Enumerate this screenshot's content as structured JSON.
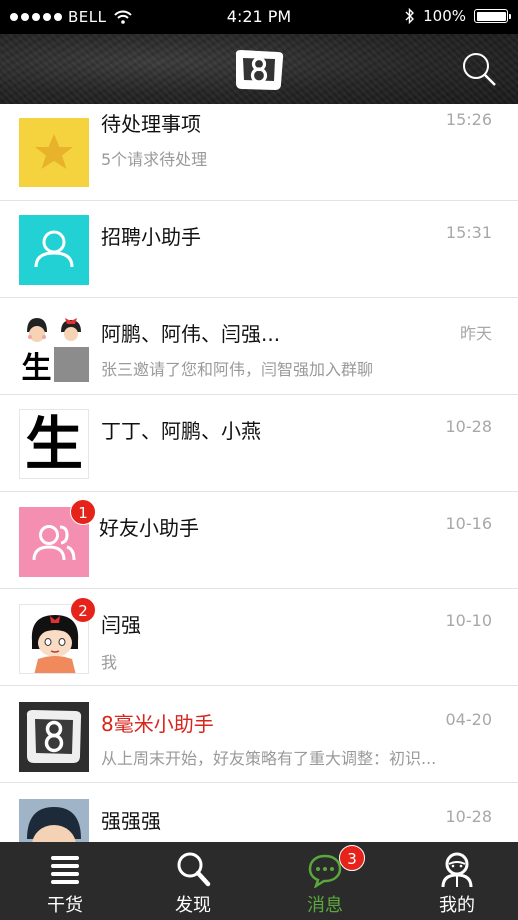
{
  "status_bar": {
    "carrier": "BELL",
    "time": "4:21 PM",
    "battery": "100%"
  },
  "header": {
    "logo_text": "8"
  },
  "messages": [
    {
      "title": "待处理事项",
      "time": "15:26",
      "subtitle": "5个请求待处理",
      "avatar": "star-icon",
      "avatar_color": "#f5d33f"
    },
    {
      "title": "招聘小助手",
      "time": "15:31",
      "subtitle": "",
      "avatar": "person-icon",
      "avatar_color": "#22d1d4"
    },
    {
      "title": "阿鹏、阿伟、闫强...",
      "time": "昨天",
      "subtitle": "张三邀请了您和阿伟，闫智强加入群聊",
      "avatar": "group-avatar"
    },
    {
      "title": "丁丁、阿鹏、小燕",
      "time": "10-28",
      "subtitle": "",
      "avatar": "calligraphy-avatar",
      "avatar_char": "生"
    },
    {
      "title": "好友小助手",
      "time": "10-16",
      "subtitle": "",
      "avatar": "friends-icon",
      "avatar_color": "#f48fb1",
      "badge": "1"
    },
    {
      "title": "闫强",
      "time": "10-10",
      "subtitle": "我",
      "avatar": "cartoon-girl-avatar",
      "badge": "2"
    },
    {
      "title": "8毫米小助手",
      "time": "04-20",
      "subtitle": "从上周末开始，好友策略有了重大调整：初识...",
      "avatar": "app-logo-avatar",
      "highlight_color": "#d9251c"
    },
    {
      "title": "强强强",
      "time": "10-28",
      "subtitle": "",
      "avatar": "cartoon-avatar"
    }
  ],
  "tabs": [
    {
      "label": "干货",
      "icon": "list-icon"
    },
    {
      "label": "发现",
      "icon": "search-icon"
    },
    {
      "label": "消息",
      "icon": "chat-icon",
      "badge": "3",
      "active": true
    },
    {
      "label": "我的",
      "icon": "profile-icon"
    }
  ],
  "colors": {
    "active_tab": "#5aa83d",
    "badge": "#e5231a",
    "tabbar_bg": "#2b2b2b"
  }
}
